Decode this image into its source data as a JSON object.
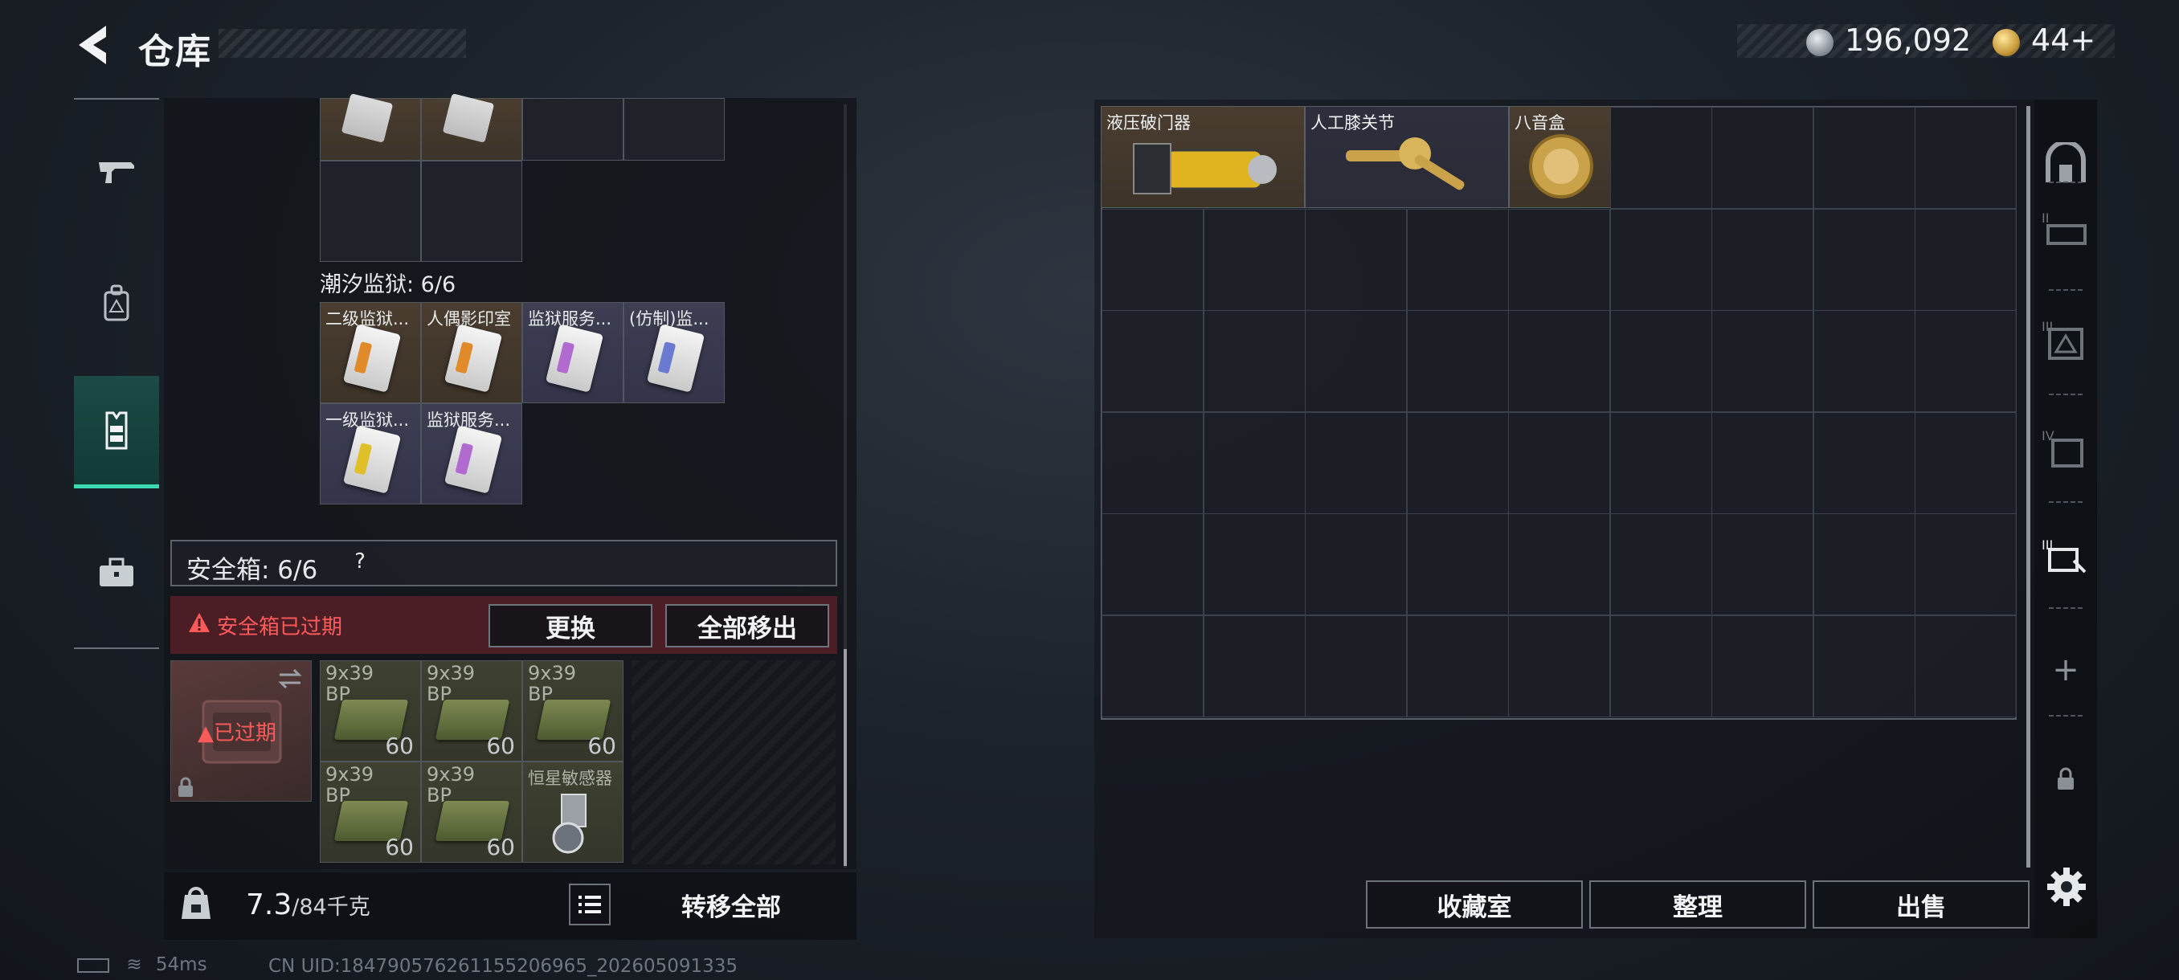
{
  "header": {
    "title": "仓库"
  },
  "currency": {
    "silver": "196,092",
    "gold": "44+"
  },
  "left_nav": {
    "items": [
      "weapon",
      "backpack",
      "vest",
      "toolbox"
    ],
    "active": "vest"
  },
  "section": {
    "label": "潮汐监狱: 6/6"
  },
  "keycards": [
    {
      "label": "二级监狱...",
      "rarity": "brown",
      "stripe": "#e08a2a"
    },
    {
      "label": "人偶影印室",
      "rarity": "brown",
      "stripe": "#e08a2a"
    },
    {
      "label": "监狱服务...",
      "rarity": "purple",
      "stripe": "#b06ad0"
    },
    {
      "label": "(仿制)监...",
      "rarity": "purple",
      "stripe": "#6a7ad0"
    },
    {
      "label": "一级监狱...",
      "rarity": "purple",
      "stripe": "#e0c02a"
    },
    {
      "label": "监狱服务...",
      "rarity": "purple",
      "stripe": "#b06ad0"
    }
  ],
  "safebox": {
    "label": "安全箱: 6/6",
    "help": "?",
    "alert": "安全箱已过期",
    "expired_badge": "已过期",
    "replace_button": "更换",
    "remove_all_button": "全部移出",
    "items": [
      {
        "caliber": "9x39",
        "sub": "BP",
        "count": "60"
      },
      {
        "caliber": "9x39",
        "sub": "BP",
        "count": "60"
      },
      {
        "caliber": "9x39",
        "sub": "BP",
        "count": "60"
      },
      {
        "caliber": "9x39",
        "sub": "BP",
        "count": "60"
      },
      {
        "caliber": "9x39",
        "sub": "BP",
        "count": "60"
      },
      {
        "caliber": "恒星敏感器",
        "sub": "",
        "count": ""
      }
    ]
  },
  "weight": {
    "current": "7.3",
    "max": "/84千克"
  },
  "transfer_all_button": "转移全部",
  "status": {
    "ping": "54ms",
    "uid": "CN UID:184790576261155206965_202605091335"
  },
  "storage_items": [
    {
      "label": "液压破门器"
    },
    {
      "label": "人工膝关节"
    },
    {
      "label": "八音盒"
    }
  ],
  "right_nav": {
    "items": [
      "home",
      "stash-2",
      "stash-3",
      "stash-4",
      "stash-5",
      "add",
      "lock"
    ],
    "add_symbol": "+"
  },
  "actions": {
    "collection_button": "收藏室",
    "sort_button": "整理",
    "sell_button": "出售"
  }
}
